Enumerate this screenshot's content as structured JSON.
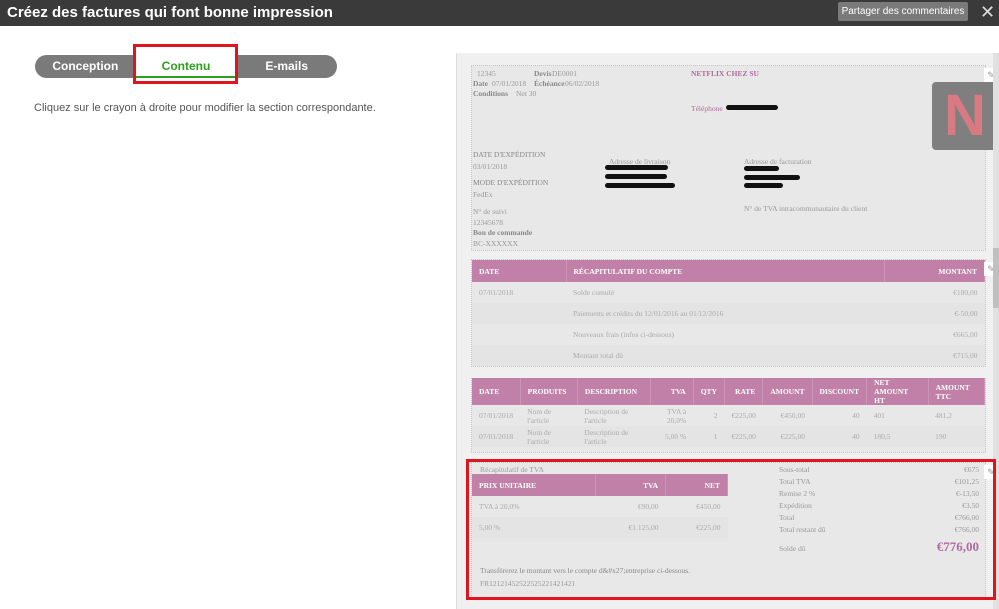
{
  "header": {
    "title": "Créez des factures qui font bonne impression",
    "share_label": "Partager des commentaires",
    "close_icon": "close-icon"
  },
  "tabs": [
    {
      "label": "Conception"
    },
    {
      "label": "Contenu",
      "active": true
    },
    {
      "label": "E-mails"
    }
  ],
  "hint": "Cliquez sur le crayon à droite pour modifier la section correspondante.",
  "invoice": {
    "number": "12345",
    "devis_label": "Devis",
    "devis": "DE0001",
    "date_label": "Date",
    "date": "07/01/2018",
    "echeance_label": "Échéance",
    "echeance": "06/02/2018",
    "conditions_label": "Conditions",
    "conditions": "Net 30",
    "company": "NETFLIX CHEZ SU",
    "phone_label": "Téléphone",
    "logo_letter": "N",
    "ship_date_label": "DATE D'EXPÉDITION",
    "ship_date": "03/01/2018",
    "ship_mode_label": "MODE D'EXPÉDITION",
    "ship_mode": "FedEx",
    "tracking_label": "N° de suivi",
    "tracking": "12345678",
    "po_label": "Bon de commande",
    "po": "BC-XXXXXX",
    "delivery_label": "Adresse de livraison",
    "billing_label": "Adresse de facturation",
    "vat_client_label": "N° de TVA intracommunautaire du client",
    "account": {
      "headers": [
        "DATE",
        "RÉCAPITULATIF DU COMPTE",
        "MONTANT"
      ],
      "rows": [
        [
          "07/01/2018",
          "Solde cumulé",
          "€100,00"
        ],
        [
          "",
          "Paiements et crédits du 12/01/2016 au 01/12/2016",
          "€-50,00"
        ],
        [
          "",
          "Nouveaux frais (infos ci-dessous)",
          "€665,00"
        ],
        [
          "",
          "Montant total dû",
          "€715,00"
        ]
      ]
    },
    "items": {
      "headers": [
        "DATE",
        "PRODUITS",
        "DESCRIPTION",
        "TVA",
        "QTY",
        "RATE",
        "AMOUNT",
        "DISCOUNT",
        "NET AMOUNT HT",
        "AMOUNT TTC"
      ],
      "rows": [
        [
          "07/01/2018",
          "Nom de l'article",
          "Description de l'article",
          "TVA à 20,0%",
          "2",
          "€225,00",
          "€450,00",
          "40",
          "401",
          "481,2"
        ],
        [
          "07/01/2018",
          "Nom de l'article",
          "Description de l'article",
          "5,00 %",
          "1",
          "€225,00",
          "€225,00",
          "40",
          "180,5",
          "190"
        ]
      ]
    },
    "vat_summary": {
      "title": "Récapitulatif de TVA",
      "headers": [
        "PRIX UNITAIRE",
        "TVA",
        "NET"
      ],
      "rows": [
        [
          "TVA à 20,0%",
          "€90,00",
          "€450,00"
        ],
        [
          "5,00 %",
          "€1.125,00",
          "€225,00"
        ]
      ]
    },
    "totals": [
      [
        "Sous-total",
        "€675"
      ],
      [
        "Total TVA",
        "€101,25"
      ],
      [
        "Remise 2 %",
        "€-13,50"
      ],
      [
        "Expédition",
        "€3,50"
      ],
      [
        "Total",
        "€766,00"
      ],
      [
        "Total restant dû",
        "€766,00"
      ]
    ],
    "balance_label": "Solde dû",
    "balance": "€776,00",
    "transfer_note": "Transférerez le montant vers le compte d&#x27;entreprise ci-dessous.",
    "iban": "FR12121452522525221421421"
  },
  "colors": {
    "accent": "#c080a8",
    "highlight": "#e0141e",
    "tab_active": "#2ca01c"
  }
}
